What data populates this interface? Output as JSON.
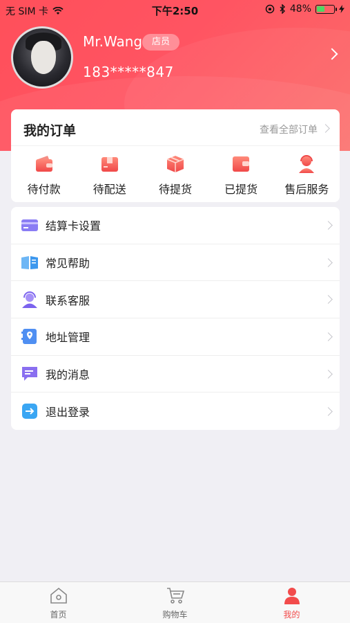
{
  "status_bar": {
    "carrier": "无 SIM 卡",
    "time": "下午2:50",
    "battery": "48%",
    "battery_level": 0.48
  },
  "profile": {
    "name": "Mr.Wang",
    "role": "店员",
    "phone": "183*****847"
  },
  "orders": {
    "title": "我的订单",
    "view_all": "查看全部订单",
    "items": [
      {
        "label": "待付款",
        "icon": "wallet-icon"
      },
      {
        "label": "待配送",
        "icon": "delivery-box-icon"
      },
      {
        "label": "待提货",
        "icon": "package-icon"
      },
      {
        "label": "已提货",
        "icon": "wallet-done-icon"
      },
      {
        "label": "售后服务",
        "icon": "service-agent-icon"
      }
    ]
  },
  "menu": {
    "items": [
      {
        "label": "结算卡设置",
        "icon": "bank-card-icon"
      },
      {
        "label": "常见帮助",
        "icon": "help-book-icon"
      },
      {
        "label": "联系客服",
        "icon": "customer-service-icon"
      },
      {
        "label": "地址管理",
        "icon": "address-icon"
      },
      {
        "label": "我的消息",
        "icon": "message-icon"
      },
      {
        "label": "退出登录",
        "icon": "logout-icon"
      }
    ]
  },
  "tabbar": {
    "items": [
      {
        "label": "首页",
        "icon": "home-icon",
        "active": false
      },
      {
        "label": "购物车",
        "icon": "cart-icon",
        "active": false
      },
      {
        "label": "我的",
        "icon": "user-icon",
        "active": true
      }
    ]
  },
  "colors": {
    "brand_red": "#ff5462",
    "active_tab": "#f24b4b",
    "background": "#f0eff4"
  }
}
